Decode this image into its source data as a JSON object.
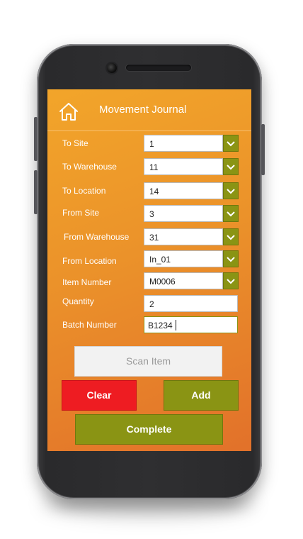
{
  "header": {
    "title": "Movement Journal",
    "home_icon": "home-icon"
  },
  "form": {
    "to_site": {
      "label": "To Site",
      "value": "1"
    },
    "to_warehouse": {
      "label": "To Warehouse",
      "value": "11"
    },
    "to_location": {
      "label": "To Location",
      "value": "14"
    },
    "from_site": {
      "label": "From Site",
      "value": "3"
    },
    "from_warehouse": {
      "label": "From Warehouse",
      "value": "31"
    },
    "from_location": {
      "label": "From Location",
      "value": "In_01"
    },
    "item_number": {
      "label": "Item Number",
      "value": "M0006"
    },
    "quantity": {
      "label": "Quantity",
      "value": "2"
    },
    "batch_number": {
      "label": "Batch Number",
      "value": "B1234"
    }
  },
  "buttons": {
    "scan": "Scan Item",
    "clear": "Clear",
    "add": "Add",
    "complete": "Complete"
  },
  "colors": {
    "accent_green": "#8a9414",
    "clear_red": "#ee1c22",
    "screen_orange": "#eb922a"
  }
}
